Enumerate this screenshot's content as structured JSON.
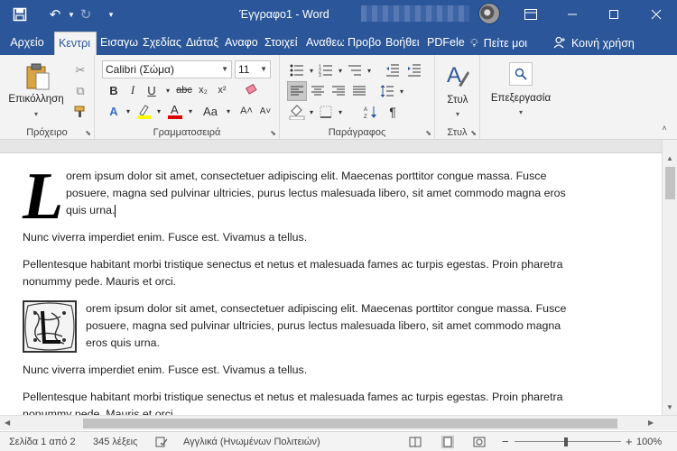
{
  "title_bar": {
    "document_title": "Έγγραφο1 - Word",
    "icons": [
      "save-icon",
      "undo-icon",
      "redo-icon",
      "customize-icon",
      "ribbon-display-icon",
      "minimize-icon",
      "maximize-icon",
      "close-icon"
    ]
  },
  "tabs": [
    {
      "label": "Αρχείο"
    },
    {
      "label": "Κεντρι"
    },
    {
      "label": "Εισαγω"
    },
    {
      "label": "Σχεδίας"
    },
    {
      "label": "Διάταξ"
    },
    {
      "label": "Αναφο"
    },
    {
      "label": "Στοιχεί"
    },
    {
      "label": "Αναθεω"
    },
    {
      "label": "Προβο"
    },
    {
      "label": "Βοήθει"
    },
    {
      "label": "PDFelei"
    }
  ],
  "tell_me": "Πείτε μοι",
  "share": "Κοινή χρήση",
  "ribbon": {
    "clipboard": {
      "paste_label": "Επικόλληση",
      "group_label": "Πρόχειρο"
    },
    "font": {
      "font_name": "Calibri (Σώμα)",
      "font_size": "11",
      "group_label": "Γραμματοσειρά",
      "bold": "B",
      "italic": "I",
      "underline": "U",
      "strike": "abc",
      "sub": "x₂",
      "sup": "x²",
      "effects": "A",
      "case": "Aa"
    },
    "paragraph": {
      "group_label": "Παράγραφος"
    },
    "styles": {
      "styles_label": "Στυλ",
      "group_label": "Στυλ"
    },
    "editing": {
      "editing_label": "Επεξεργασία"
    }
  },
  "document": {
    "dropcap_letter": "L",
    "p1": "orem ipsum dolor sit amet, consectetuer adipiscing elit. Maecenas porttitor congue massa. Fusce posuere, magna sed pulvinar ultricies, purus lectus malesuada libero, sit amet commodo magna eros quis urna.",
    "p2": "Nunc viverra imperdiet enim. Fusce est. Vivamus a tellus.",
    "p3": "Pellentesque habitant morbi tristique senectus et netus et malesuada fames ac turpis egestas. Proin pharetra nonummy pede. Mauris et orci.",
    "p4": "orem ipsum dolor sit amet, consectetuer adipiscing elit. Maecenas porttitor congue massa. Fusce posuere, magna sed pulvinar ultricies, purus lectus malesuada libero, sit amet commodo magna eros quis urna.",
    "p5": "Nunc viverra imperdiet enim. Fusce est. Vivamus a tellus.",
    "p6": "Pellentesque habitant morbi tristique senectus et netus et malesuada fames ac turpis egestas. Proin pharetra nonummy pede. Mauris et orci."
  },
  "status_bar": {
    "page": "Σελίδα 1 από 2",
    "words": "345 λέξεις",
    "language": "Αγγλικά (Ηνωμένων Πολιτειών)",
    "zoom": "100%"
  },
  "colors": {
    "accent": "#2b579a",
    "ribbon_bg": "#f3f3f3",
    "highlight": "#ffff00",
    "font_color": "#e00000"
  }
}
